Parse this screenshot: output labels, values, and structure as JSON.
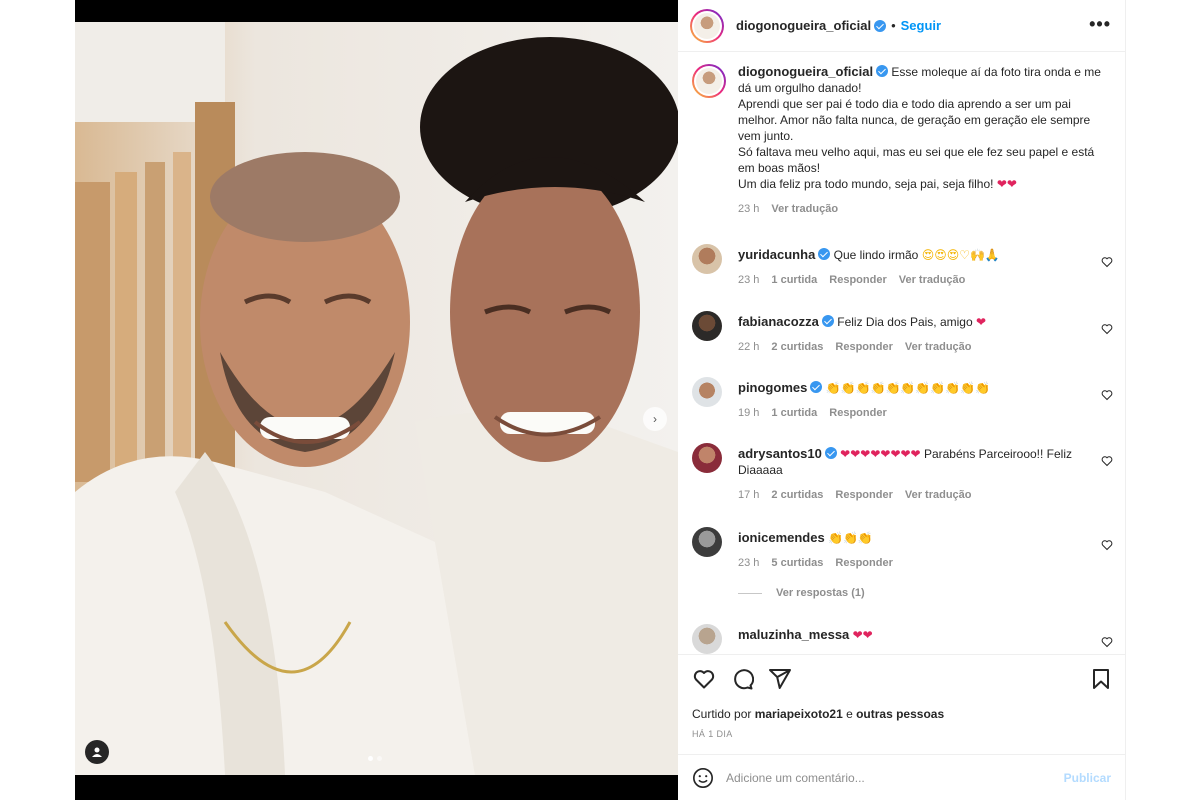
{
  "post": {
    "username": "diogonogueira_oficial",
    "follow_label": "Seguir",
    "more_label": "•••",
    "dot": "•"
  },
  "caption": {
    "username": "diogonogueira_oficial",
    "lines": [
      "Esse moleque aí da foto tira onda e me dá um orgulho danado!",
      "Aprendi que ser pai é todo dia e todo dia aprendo a ser um pai melhor. Amor não falta nunca, de geração em geração ele sempre vem junto.",
      "Só faltava meu velho aqui, mas eu sei que ele fez seu papel e está em boas mãos!",
      "Um dia feliz pra todo mundo, seja pai, seja filho! "
    ],
    "end_emoji": "❤❤",
    "time": "23 h",
    "translate": "Ver tradução"
  },
  "comments": [
    {
      "user": "yuridacunha",
      "verified": true,
      "text": "Que lindo irmão ",
      "emoji": "😍😍😍♡🙌🙏",
      "time": "23 h",
      "likes": "1 curtida",
      "reply": "Responder",
      "translate": "Ver tradução"
    },
    {
      "user": "fabianacozza",
      "verified": true,
      "text": "Feliz Dia dos Pais, amigo ",
      "emoji": "❤",
      "time": "22 h",
      "likes": "2 curtidas",
      "reply": "Responder",
      "translate": "Ver tradução"
    },
    {
      "user": "pinogomes",
      "verified": true,
      "text": "",
      "emoji": "👏👏👏👏👏👏👏👏👏👏👏",
      "time": "19 h",
      "likes": "1 curtida",
      "reply": "Responder",
      "translate": ""
    },
    {
      "user": "adrysantos10",
      "verified": true,
      "text": " Parabéns Parceirooo!! Feliz Diaaaaa",
      "emoji": "❤❤❤❤❤❤❤❤",
      "time": "17 h",
      "likes": "2 curtidas",
      "reply": "Responder",
      "translate": "Ver tradução"
    },
    {
      "user": "ionicemendes",
      "verified": false,
      "text": "",
      "emoji": "👏👏👏",
      "time": "23 h",
      "likes": "5 curtidas",
      "reply": "Responder",
      "translate": ""
    },
    {
      "user": "maluzinha_messa",
      "verified": false,
      "text": "",
      "emoji": "❤❤",
      "time": "",
      "likes": "",
      "reply": "",
      "translate": ""
    }
  ],
  "view_replies": "Ver respostas (1)",
  "likes_line": {
    "prefix": "Curtido por ",
    "user": "mariapeixoto21",
    "middle": " e ",
    "others": "outras pessoas"
  },
  "posted_when": "HÁ 1 DIA",
  "comment_input": {
    "placeholder": "Adicione um comentário...",
    "publish": "Publicar"
  },
  "colors": {
    "accent": "#0095f6",
    "heart": "#e0245e",
    "verified": "#3897f0"
  },
  "icons": [
    "heart-icon",
    "comment-icon",
    "share-icon",
    "bookmark-icon",
    "emoji-icon",
    "user-tag-icon",
    "chevron-right-icon",
    "more-icon"
  ]
}
